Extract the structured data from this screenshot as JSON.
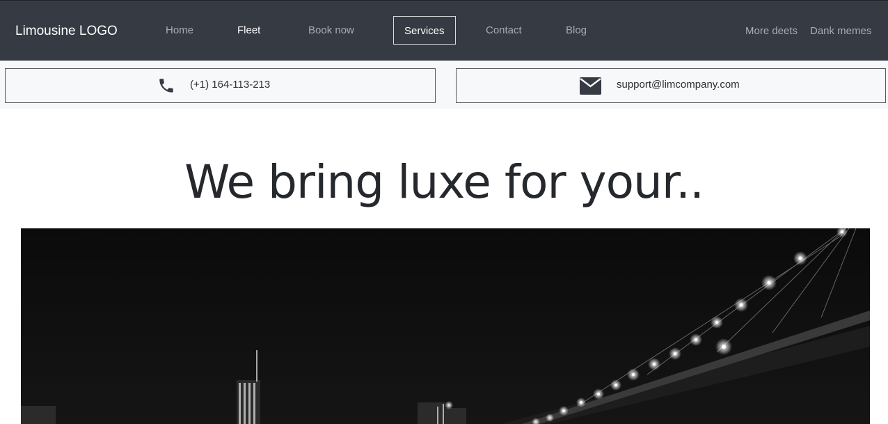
{
  "nav": {
    "brand": "Limousine LOGO",
    "links": [
      {
        "label": "Home",
        "state": "default"
      },
      {
        "label": "Fleet",
        "state": "active"
      },
      {
        "label": "Book now",
        "state": "default"
      },
      {
        "label": "Services",
        "state": "boxed"
      },
      {
        "label": "Contact",
        "state": "default"
      },
      {
        "label": "Blog",
        "state": "default"
      }
    ],
    "right_links": [
      {
        "label": "More deets"
      },
      {
        "label": "Dank memes"
      }
    ]
  },
  "contact": {
    "phone": {
      "icon": "phone-icon",
      "text": "(+1) 164-113-213"
    },
    "email": {
      "icon": "envelope-icon",
      "text": "support@limcompany.com"
    }
  },
  "hero": {
    "title": "We bring luxe for your..",
    "image": "night-city-bridge-photo"
  },
  "colors": {
    "navbar_bg": "#353a43",
    "nav_text": "#a9adb3",
    "nav_active": "#ffffff",
    "contact_bg": "#f7f8fa",
    "hero_text": "#25282c"
  }
}
